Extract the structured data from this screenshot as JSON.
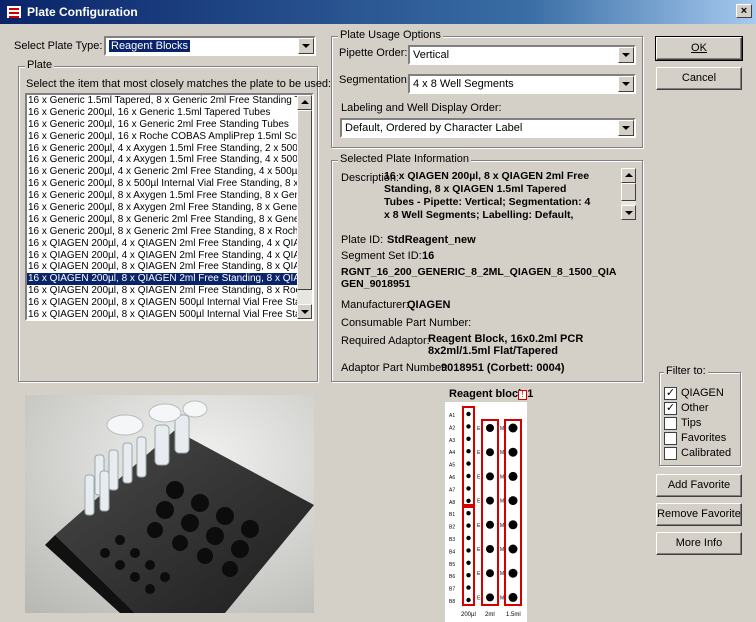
{
  "window": {
    "title": "Plate Configuration",
    "close_glyph": "×"
  },
  "plate_type": {
    "label": "Select Plate Type:",
    "value": "Reagent Blocks"
  },
  "plate_group": {
    "title": "Plate",
    "instruction": "Select the item that most closely matches the plate to be used:",
    "items": [
      "16 x Generic 1.5ml Tapered, 8 x Generic 2ml Free Standing Tu",
      "16 x Generic 200µl, 16 x Generic 1.5ml Tapered Tubes",
      "16 x Generic 200µl, 16 x Generic 2ml Free Standing Tubes",
      "16 x Generic 200µl, 16 x Roche COBAS AmpliPrep 1.5ml Scre",
      "16 x Generic 200µl, 4 x Axygen 1.5ml Free Standing, 2 x 500µ",
      "16 x Generic 200µl, 4 x Axygen 1.5ml Free Standing, 4 x 500µ",
      "16 x Generic 200µl, 4 x Generic 2ml Free Standing, 4 x 500µl I",
      "16 x Generic 200µl, 8 x 500µl Internal Vial Free Standing, 8 x (",
      "16 x Generic 200µl, 8 x Axygen 1.5ml Free Standing, 8 x Gene",
      "16 x Generic 200µl, 8 x Axygen 2ml Free Standing, 8 x Generi",
      "16 x Generic 200µl, 8 x Generic 2ml Free Standing, 8 x Generi",
      "16 x Generic 200µl, 8 x Generic 2ml Free Standing, 8 x Roche",
      "16 x QIAGEN 200µl, 4 x QIAGEN 2ml Free Standing, 4 x QIAG",
      "16 x QIAGEN 200µl, 4 x QIAGEN 2ml Free Standing, 4 x QIAG",
      "16 x QIAGEN 200µl, 8 x QIAGEN 2ml Free Standing, 8 x QIAG",
      "16 x QIAGEN 200µl, 8 x QIAGEN 2ml Free Standing, 8 x QIAG",
      "16 x QIAGEN 200µl, 8 x QIAGEN 2ml Free Standing, 8 x Rock",
      "16 x QIAGEN 200µl, 8 x QIAGEN 500µl Internal Vial Free Star",
      "16 x QIAGEN 200µl, 8 x QIAGEN 500µl Internal Vial Free Star"
    ],
    "selected_index": 15
  },
  "usage": {
    "title": "Plate Usage Options",
    "pipette_label": "Pipette Order:",
    "pipette_value": "Vertical",
    "segmentation_label": "Segmentation:",
    "segmentation_value": "4 x 8 Well Segments",
    "labeling_label": "Labeling and Well Display Order:",
    "labeling_value": "Default, Ordered by Character Label"
  },
  "info": {
    "title": "Selected Plate Information",
    "description_label": "Description:",
    "description_lines": [
      "16 x QIAGEN 200µl, 8 x QIAGEN 2ml Free",
      "Standing, 8 x QIAGEN 1.5ml Tapered",
      "Tubes - Pipette: Vertical; Segmentation: 4",
      "x 8 Well Segments; Labelling: Default,"
    ],
    "plate_id_label": "Plate ID:",
    "plate_id": "StdReagent_new",
    "segment_set_label": "Segment Set ID:",
    "segment_set": "16",
    "code_lines": [
      "RGNT_16_200_GENERIC_8_2ML_QIAGEN_8_1500_QIA",
      "GEN_9018951"
    ],
    "manufacturer_label": "Manufacturer:",
    "manufacturer": "QIAGEN",
    "consumable_label": "Consumable Part Number:",
    "adaptor_label": "Required Adaptor:",
    "adaptor_lines": [
      "Reagent Block, 16x0.2ml PCR",
      "8x2ml/1.5ml Flat/Tapered"
    ],
    "adaptor_part_label": "Adaptor Part Number:",
    "adaptor_part": "9018951 (Corbett: 0004)"
  },
  "buttons": {
    "ok": "OK",
    "cancel": "Cancel",
    "add_favorite": "Add Favorite",
    "remove_favorite": "Remove Favorite",
    "more_info": "More Info"
  },
  "filter": {
    "title": "Filter to:",
    "items": [
      {
        "label": "QIAGEN",
        "checked": true
      },
      {
        "label": "Other",
        "checked": true
      },
      {
        "label": "Tips",
        "checked": false
      },
      {
        "label": "Favorites",
        "checked": false
      },
      {
        "label": "Calibrated",
        "checked": false
      }
    ]
  },
  "diagram": {
    "title": "Reagent block 1",
    "badge": "!",
    "col1_labels": [
      "A1",
      "A2",
      "A3",
      "A4",
      "A5",
      "A6",
      "A7",
      "A8",
      "B1",
      "B2",
      "B3",
      "B4",
      "B5",
      "B6",
      "B7",
      "B8"
    ],
    "col2_labels": [
      "E",
      "E",
      "E",
      "E",
      "E",
      "E",
      "E",
      "E"
    ],
    "col3_labels": [
      "M",
      "M",
      "M",
      "M",
      "M",
      "M",
      "M",
      "M"
    ],
    "bottom_labels": [
      "200µl",
      "2ml",
      "1.5ml"
    ],
    "accent": "#d40000"
  }
}
